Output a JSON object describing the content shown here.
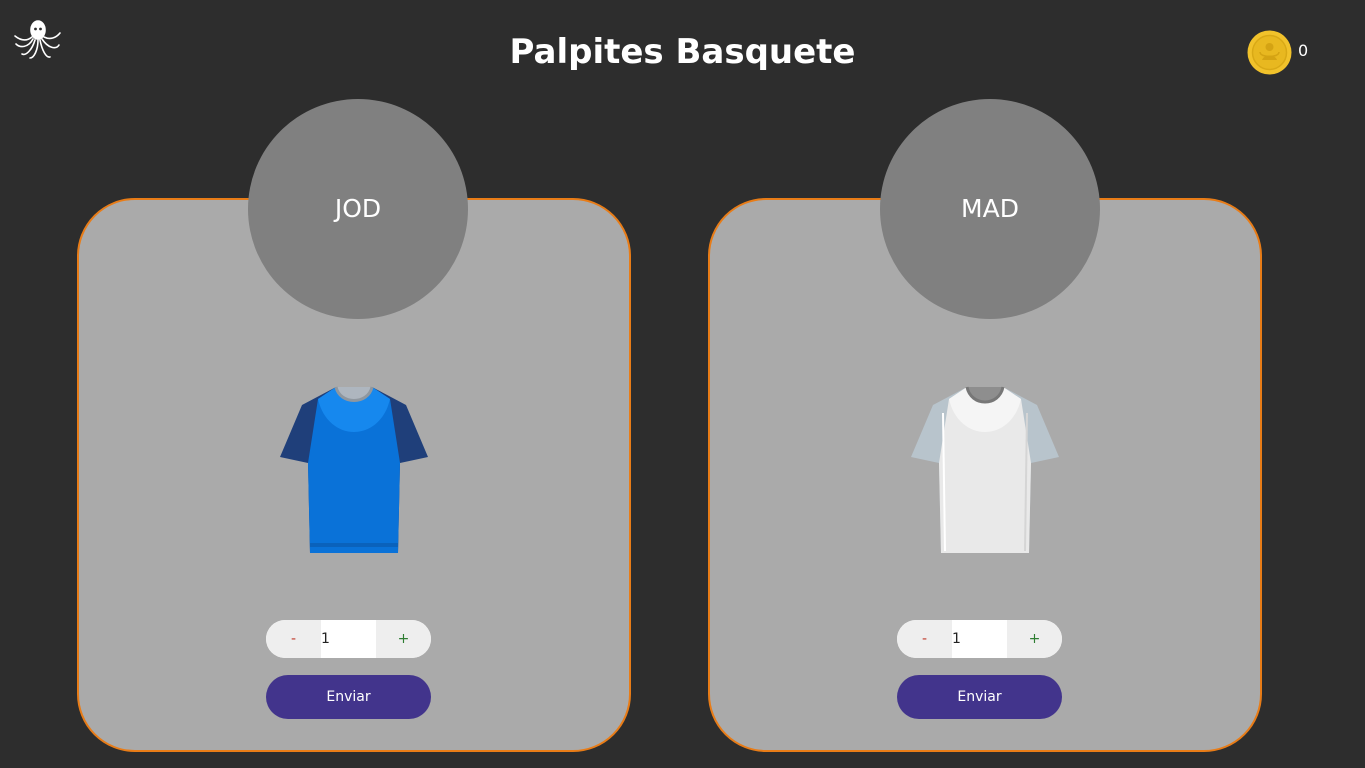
{
  "header": {
    "title": "Palpites Basquete",
    "coin_count": "0",
    "logo_icon": "octopus-icon",
    "coin_icon": "gold-coin-icon"
  },
  "colors": {
    "background": "#2d2d2d",
    "card": "#aaaaaa",
    "card_border": "#e87c17",
    "team_circle": "#808080",
    "send_button": "#42348c"
  },
  "teams": [
    {
      "code": "JOD",
      "shirt_icon": "blue-jersey-icon",
      "quantity": "1",
      "minus_label": "-",
      "plus_label": "+",
      "send_label": "Enviar"
    },
    {
      "code": "MAD",
      "shirt_icon": "white-jersey-icon",
      "quantity": "1",
      "minus_label": "-",
      "plus_label": "+",
      "send_label": "Enviar"
    }
  ]
}
